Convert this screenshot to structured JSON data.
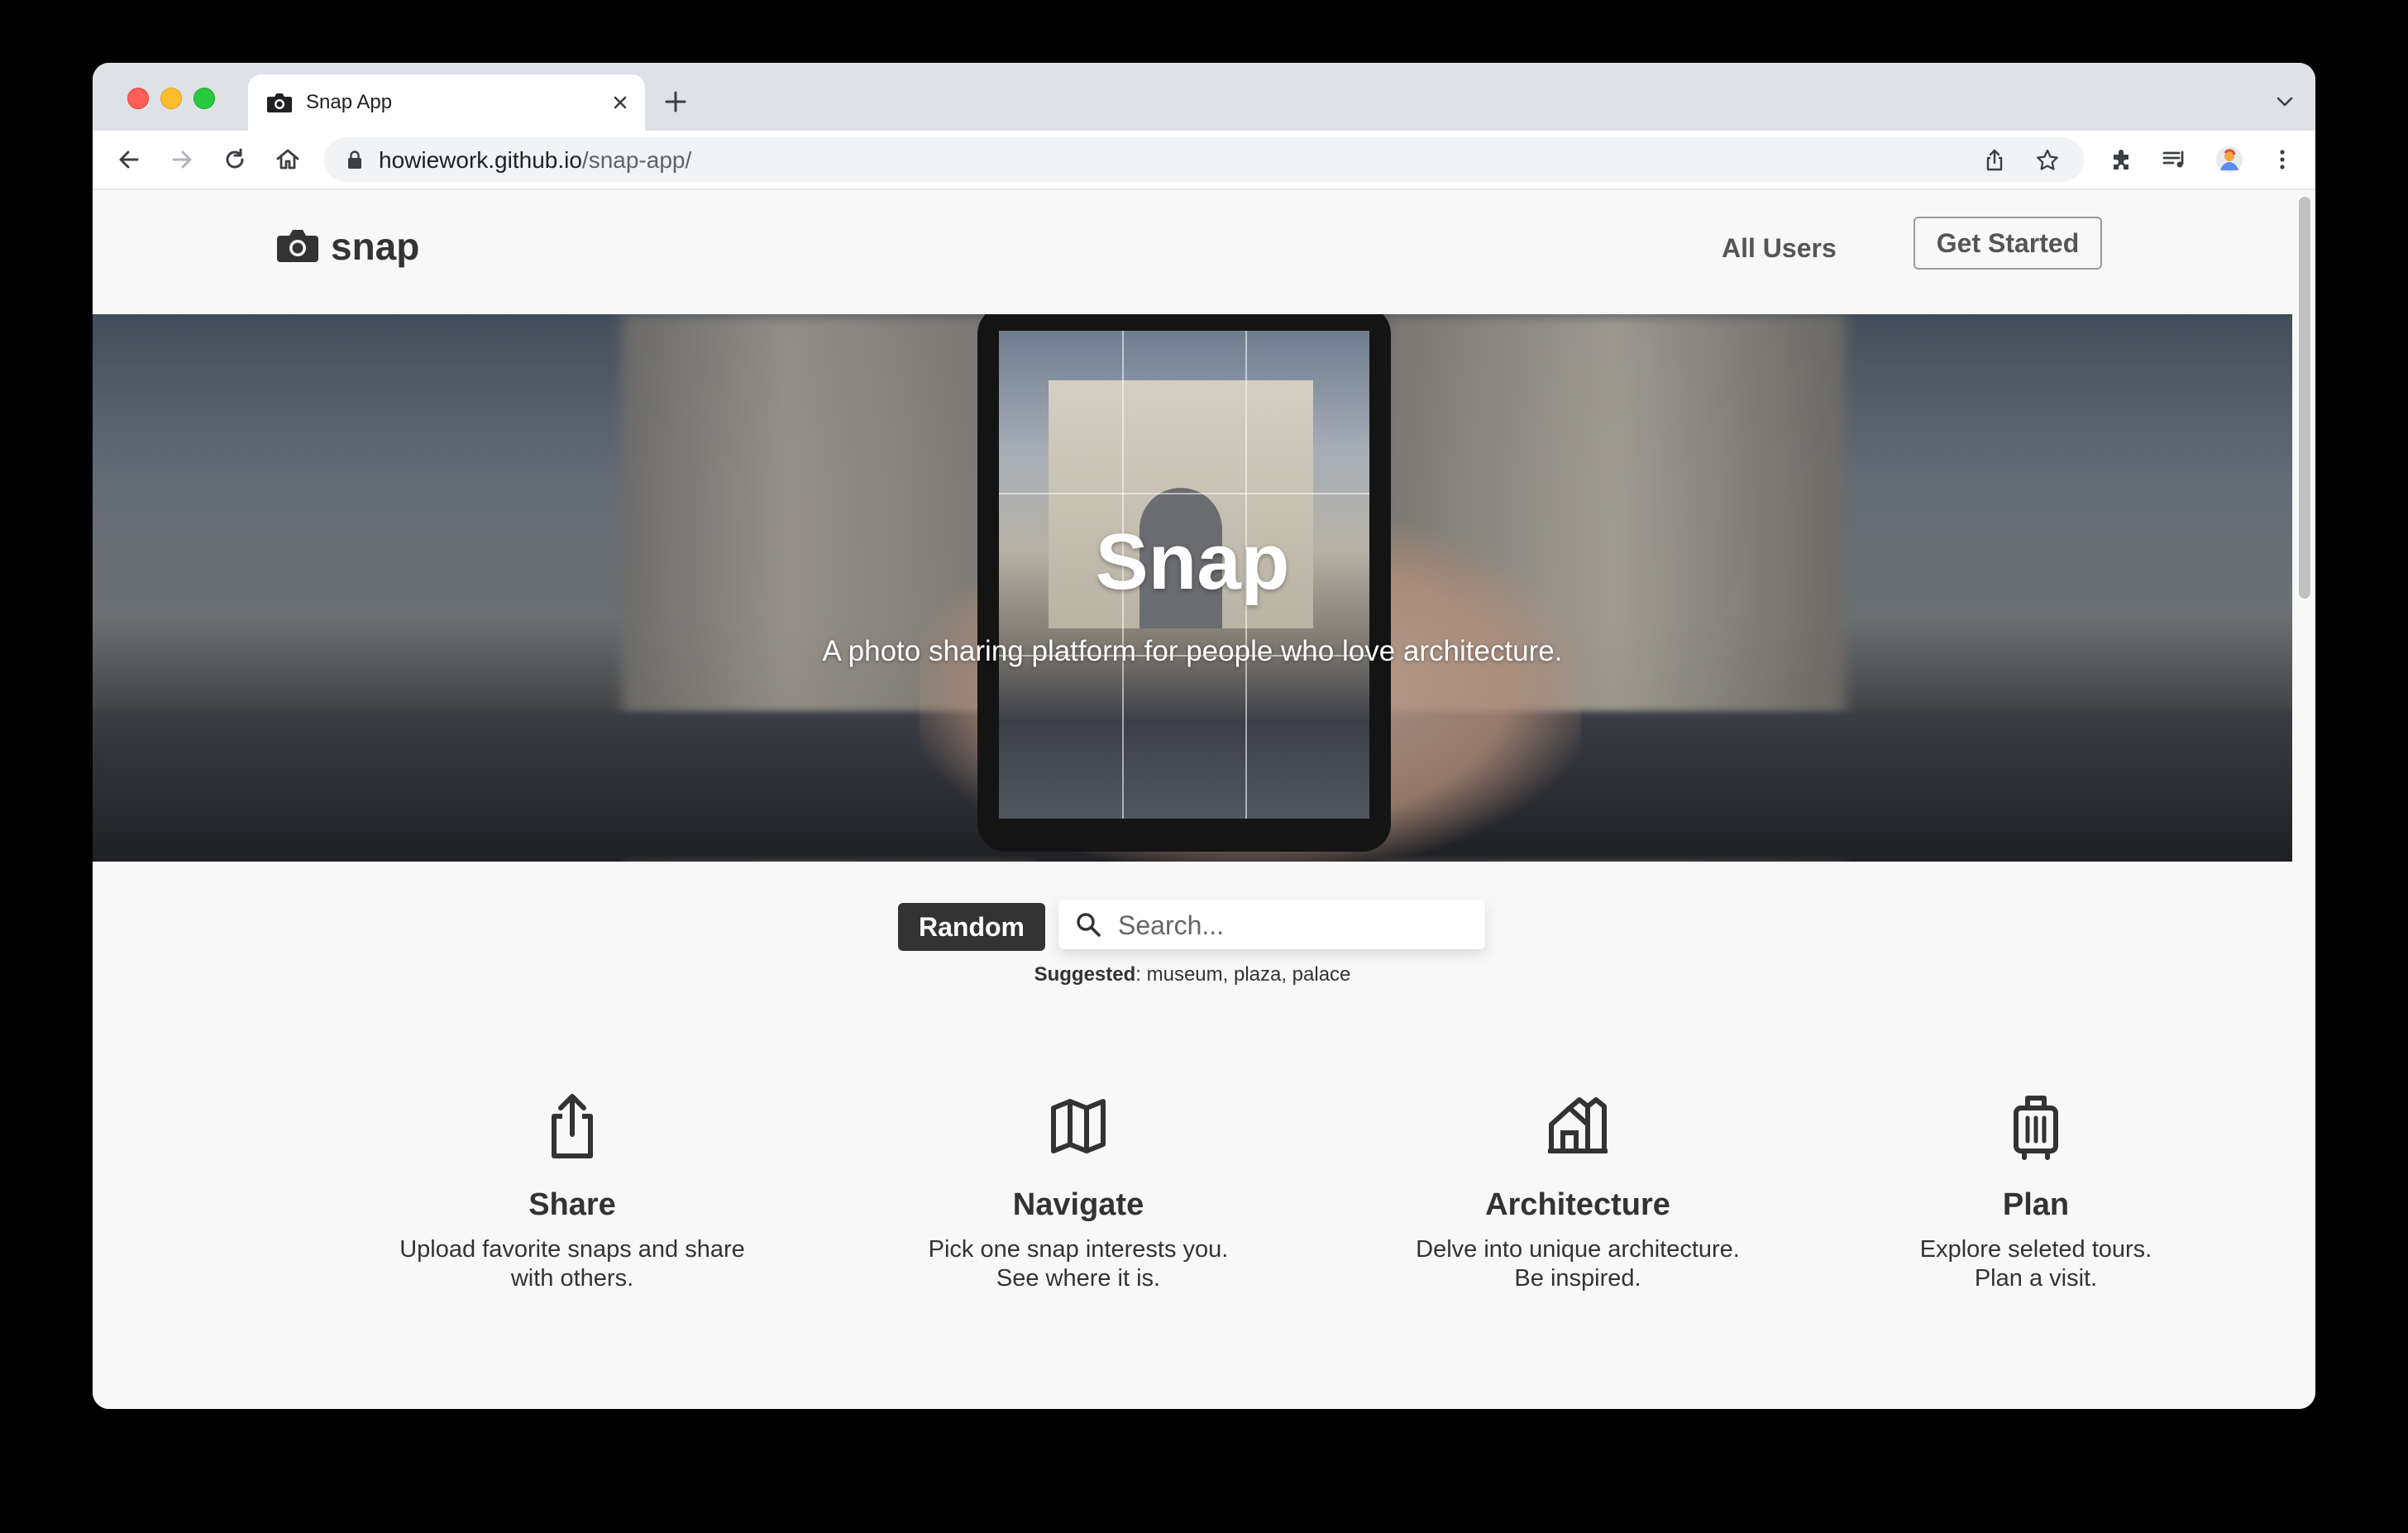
{
  "browser": {
    "tab": {
      "title": "Snap App"
    },
    "address": {
      "host": "howiework.github.io",
      "path": "/snap-app/"
    }
  },
  "site": {
    "brand": "snap",
    "nav": {
      "all_users": "All Users",
      "get_started": "Get Started"
    },
    "hero": {
      "title": "Snap",
      "subtitle": "A photo sharing platform for people who love architecture."
    },
    "search": {
      "random_label": "Random",
      "placeholder": "Search...",
      "suggested_label": "Suggested",
      "suggested_items": "museum, plaza, palace"
    },
    "features": [
      {
        "icon": "share-icon",
        "title": "Share",
        "line1": "Upload favorite snaps and share",
        "line2": "with others."
      },
      {
        "icon": "map-icon",
        "title": "Navigate",
        "line1": "Pick one snap interests you.",
        "line2": "See where it is."
      },
      {
        "icon": "buildings-icon",
        "title": "Architecture",
        "line1": "Delve into unique architecture.",
        "line2": "Be inspired."
      },
      {
        "icon": "luggage-icon",
        "title": "Plan",
        "line1": "Explore seleted tours.",
        "line2": "Plan a visit."
      }
    ]
  },
  "colors": {
    "page_background": "#f8f8f8",
    "text_dark": "#333333",
    "tabstrip": "#dee1e6",
    "random_button": "#333333"
  }
}
